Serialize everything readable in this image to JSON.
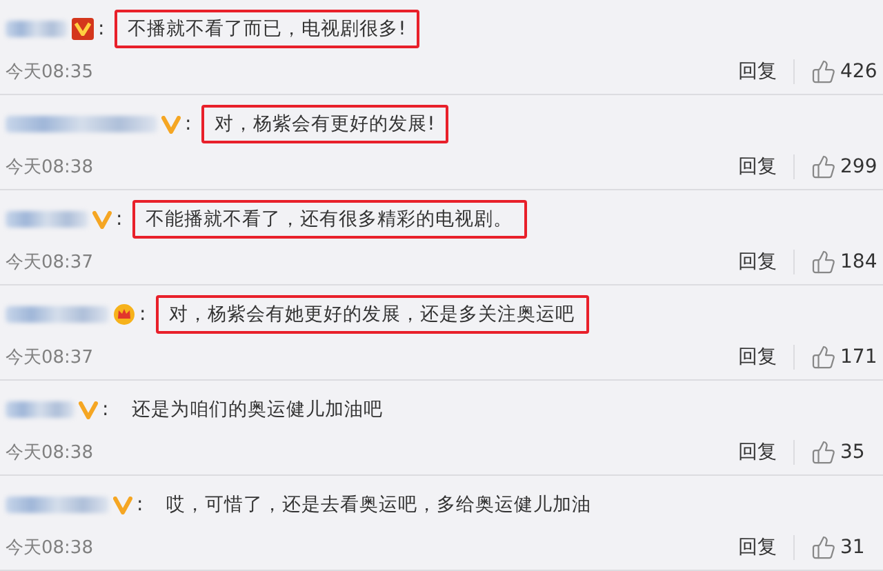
{
  "comments": [
    {
      "kind": "v-red",
      "colon": ":",
      "text": "不播就不看了而已，电视剧很多!",
      "highlighted": true,
      "time": "今天08:35",
      "reply": "回复",
      "likes": "426"
    },
    {
      "kind": "v-gold",
      "colon": ":",
      "text": "对，杨紫会有更好的发展!",
      "highlighted": true,
      "time": "今天08:38",
      "reply": "回复",
      "likes": "299"
    },
    {
      "kind": "v-gold",
      "colon": ":",
      "text": "不能播就不看了，还有很多精彩的电视剧。",
      "highlighted": true,
      "time": "今天08:37",
      "reply": "回复",
      "likes": "184"
    },
    {
      "kind": "crown",
      "colon": ":",
      "text": "对，杨紫会有她更好的发展，还是多关注奥运吧",
      "highlighted": true,
      "time": "今天08:37",
      "reply": "回复",
      "likes": "171"
    },
    {
      "kind": "v-gold",
      "colon": ":",
      "text": "还是为咱们的奥运健儿加油吧",
      "highlighted": false,
      "time": "今天08:38",
      "reply": "回复",
      "likes": "35"
    },
    {
      "kind": "v-gold",
      "colon": ":",
      "text": "哎，可惜了，还是去看奥运吧，多给奥运健儿加油",
      "highlighted": false,
      "time": "今天08:38",
      "reply": "回复",
      "likes": "31"
    }
  ]
}
